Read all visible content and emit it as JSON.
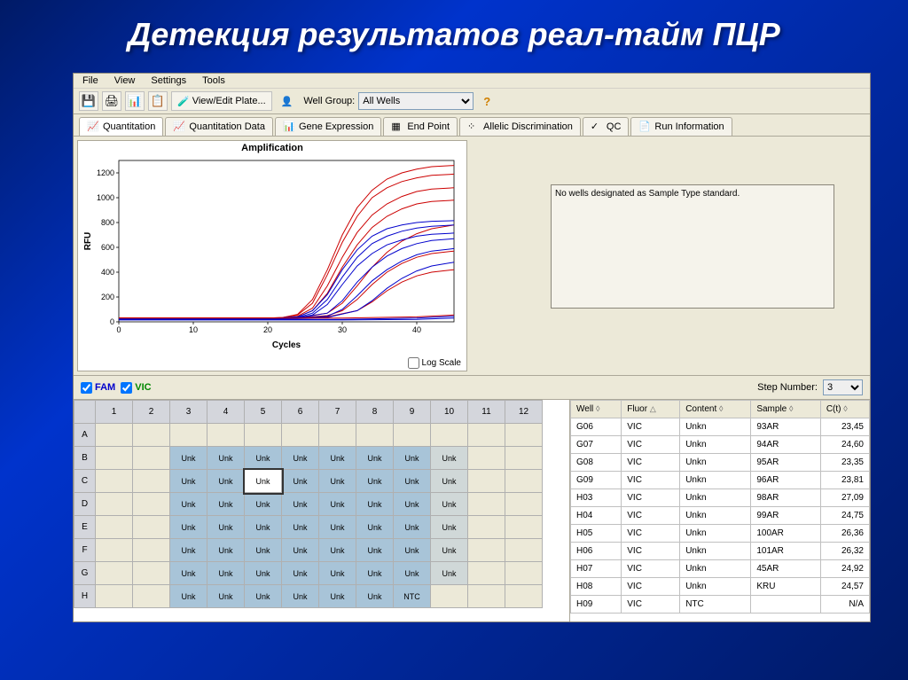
{
  "slide": {
    "title": "Детекция результатов  реал-тайм ПЦР"
  },
  "menu": {
    "file": "File",
    "view": "View",
    "settings": "Settings",
    "tools": "Tools"
  },
  "toolbar": {
    "view_edit_plate": "View/Edit Plate...",
    "well_group_label": "Well Group:",
    "well_group_value": "All Wells"
  },
  "tabs": {
    "quantitation": "Quantitation",
    "quantitation_data": "Quantitation Data",
    "gene_expression": "Gene Expression",
    "end_point": "End Point",
    "allelic": "Allelic Discrimination",
    "qc": "QC",
    "run_info": "Run Information"
  },
  "chart": {
    "title": "Amplification",
    "ylabel": "RFU",
    "xlabel": "Cycles",
    "log_scale": "Log Scale"
  },
  "chart_data": {
    "type": "line",
    "title": "Amplification",
    "xlabel": "Cycles",
    "ylabel": "RFU",
    "xlim": [
      0,
      45
    ],
    "ylim": [
      0,
      1300
    ],
    "xticks": [
      0,
      10,
      20,
      30,
      40
    ],
    "yticks": [
      0,
      200,
      400,
      600,
      800,
      1000,
      1200
    ],
    "series": [
      {
        "name": "red-high-1",
        "color": "#cc0000",
        "x": [
          0,
          5,
          10,
          15,
          20,
          22,
          24,
          26,
          28,
          30,
          32,
          34,
          36,
          38,
          40,
          42,
          45
        ],
        "y": [
          30,
          30,
          30,
          30,
          30,
          35,
          60,
          180,
          420,
          700,
          920,
          1060,
          1150,
          1200,
          1230,
          1250,
          1260
        ]
      },
      {
        "name": "red-high-2",
        "color": "#cc0000",
        "x": [
          0,
          5,
          10,
          15,
          20,
          22,
          24,
          26,
          28,
          30,
          32,
          34,
          36,
          38,
          40,
          42,
          45
        ],
        "y": [
          30,
          30,
          30,
          30,
          30,
          35,
          55,
          150,
          380,
          640,
          850,
          1000,
          1080,
          1130,
          1160,
          1180,
          1190
        ]
      },
      {
        "name": "red-mid-1",
        "color": "#cc0000",
        "x": [
          0,
          5,
          10,
          15,
          20,
          22,
          24,
          26,
          28,
          30,
          32,
          34,
          36,
          38,
          40,
          42,
          45
        ],
        "y": [
          30,
          30,
          30,
          30,
          30,
          32,
          45,
          110,
          290,
          520,
          720,
          860,
          950,
          1010,
          1050,
          1070,
          1080
        ]
      },
      {
        "name": "red-mid-2",
        "color": "#cc0000",
        "x": [
          0,
          5,
          10,
          15,
          20,
          22,
          24,
          26,
          28,
          30,
          32,
          34,
          36,
          38,
          40,
          42,
          45
        ],
        "y": [
          30,
          30,
          30,
          30,
          30,
          30,
          40,
          90,
          230,
          440,
          620,
          760,
          850,
          910,
          950,
          970,
          980
        ]
      },
      {
        "name": "red-low-1",
        "color": "#cc0000",
        "x": [
          0,
          5,
          10,
          15,
          20,
          24,
          28,
          30,
          32,
          34,
          36,
          38,
          40,
          42,
          45
        ],
        "y": [
          30,
          30,
          30,
          30,
          30,
          35,
          70,
          150,
          290,
          440,
          560,
          650,
          710,
          750,
          780
        ]
      },
      {
        "name": "red-low-2",
        "color": "#cc0000",
        "x": [
          0,
          5,
          10,
          15,
          20,
          24,
          28,
          30,
          32,
          34,
          36,
          38,
          40,
          42,
          45
        ],
        "y": [
          30,
          30,
          30,
          30,
          30,
          32,
          50,
          90,
          180,
          300,
          400,
          470,
          520,
          550,
          570
        ]
      },
      {
        "name": "red-low-3",
        "color": "#cc0000",
        "x": [
          0,
          5,
          10,
          15,
          20,
          24,
          28,
          32,
          34,
          36,
          38,
          40,
          42,
          45
        ],
        "y": [
          30,
          30,
          30,
          30,
          30,
          30,
          40,
          90,
          160,
          250,
          320,
          370,
          400,
          420
        ]
      },
      {
        "name": "blue-high-1",
        "color": "#0000cc",
        "x": [
          0,
          5,
          10,
          15,
          20,
          24,
          26,
          28,
          30,
          32,
          34,
          36,
          38,
          40,
          42,
          45
        ],
        "y": [
          25,
          25,
          25,
          25,
          25,
          40,
          90,
          220,
          420,
          580,
          690,
          750,
          780,
          800,
          810,
          815
        ]
      },
      {
        "name": "blue-high-2",
        "color": "#0000cc",
        "x": [
          0,
          5,
          10,
          15,
          20,
          24,
          26,
          28,
          30,
          32,
          34,
          36,
          38,
          40,
          42,
          45
        ],
        "y": [
          25,
          25,
          25,
          25,
          25,
          35,
          70,
          180,
          360,
          520,
          630,
          690,
          730,
          755,
          770,
          780
        ]
      },
      {
        "name": "blue-mid-1",
        "color": "#0000cc",
        "x": [
          0,
          5,
          10,
          15,
          20,
          24,
          26,
          28,
          30,
          32,
          34,
          36,
          38,
          40,
          42,
          45
        ],
        "y": [
          25,
          25,
          25,
          25,
          25,
          30,
          55,
          140,
          300,
          450,
          550,
          620,
          660,
          690,
          705,
          715
        ]
      },
      {
        "name": "blue-mid-2",
        "color": "#0000cc",
        "x": [
          0,
          5,
          10,
          15,
          20,
          24,
          28,
          30,
          32,
          34,
          36,
          38,
          40,
          42,
          45
        ],
        "y": [
          25,
          25,
          25,
          25,
          25,
          30,
          70,
          170,
          320,
          440,
          530,
          590,
          630,
          655,
          670
        ]
      },
      {
        "name": "blue-low-1",
        "color": "#0000cc",
        "x": [
          0,
          5,
          10,
          15,
          20,
          24,
          28,
          30,
          32,
          34,
          36,
          38,
          40,
          42,
          45
        ],
        "y": [
          25,
          25,
          25,
          25,
          25,
          28,
          45,
          100,
          210,
          330,
          420,
          490,
          540,
          570,
          590
        ]
      },
      {
        "name": "blue-low-2",
        "color": "#0000cc",
        "x": [
          0,
          5,
          10,
          15,
          20,
          24,
          28,
          32,
          34,
          36,
          38,
          40,
          42,
          45
        ],
        "y": [
          25,
          25,
          25,
          25,
          25,
          27,
          35,
          90,
          170,
          270,
          350,
          410,
          450,
          480
        ]
      },
      {
        "name": "flat-red-1",
        "color": "#cc0000",
        "x": [
          0,
          10,
          20,
          30,
          40,
          45
        ],
        "y": [
          30,
          30,
          30,
          30,
          40,
          55
        ]
      },
      {
        "name": "flat-blue-1",
        "color": "#0000cc",
        "x": [
          0,
          10,
          20,
          30,
          40,
          45
        ],
        "y": [
          20,
          20,
          20,
          20,
          30,
          45
        ]
      },
      {
        "name": "flat-blue-2",
        "color": "#0000cc",
        "x": [
          0,
          10,
          20,
          30,
          40,
          45
        ],
        "y": [
          15,
          15,
          15,
          15,
          20,
          30
        ]
      }
    ]
  },
  "info_panel": {
    "message": "No wells designated as Sample Type standard."
  },
  "fluor": {
    "fam": "FAM",
    "vic": "VIC",
    "step_label": "Step Number:",
    "step_value": "3"
  },
  "plate": {
    "cols": [
      "1",
      "2",
      "3",
      "4",
      "5",
      "6",
      "7",
      "8",
      "9",
      "10",
      "11",
      "12"
    ],
    "rows": [
      "A",
      "B",
      "C",
      "D",
      "E",
      "F",
      "G",
      "H"
    ],
    "unk_label": "Unk",
    "ntc_label": "NTC",
    "layout": {
      "A": [
        "",
        "",
        "",
        "",
        "",
        "",
        "",
        "",
        "",
        "",
        "",
        ""
      ],
      "B": [
        "",
        "",
        "Unk",
        "Unk",
        "Unk",
        "Unk",
        "Unk",
        "Unk",
        "Unk",
        "UnkL",
        "",
        ""
      ],
      "C": [
        "",
        "",
        "Unk",
        "Unk",
        "UnkS",
        "Unk",
        "Unk",
        "Unk",
        "Unk",
        "UnkL",
        "",
        ""
      ],
      "D": [
        "",
        "",
        "Unk",
        "Unk",
        "Unk",
        "Unk",
        "Unk",
        "Unk",
        "Unk",
        "UnkL",
        "",
        ""
      ],
      "E": [
        "",
        "",
        "Unk",
        "Unk",
        "Unk",
        "Unk",
        "Unk",
        "Unk",
        "Unk",
        "UnkL",
        "",
        ""
      ],
      "F": [
        "",
        "",
        "Unk",
        "Unk",
        "Unk",
        "Unk",
        "Unk",
        "Unk",
        "Unk",
        "UnkL",
        "",
        ""
      ],
      "G": [
        "",
        "",
        "Unk",
        "Unk",
        "Unk",
        "Unk",
        "Unk",
        "Unk",
        "Unk",
        "UnkL",
        "",
        ""
      ],
      "H": [
        "",
        "",
        "Unk",
        "Unk",
        "Unk",
        "Unk",
        "Unk",
        "Unk",
        "NTC",
        "",
        "",
        ""
      ]
    }
  },
  "data_table": {
    "headers": {
      "well": "Well",
      "fluor": "Fluor",
      "content": "Content",
      "sample": "Sample",
      "cq": "C(t)"
    },
    "rows": [
      {
        "well": "G06",
        "fluor": "VIC",
        "content": "Unkn",
        "sample": "93AR",
        "cq": "23,45"
      },
      {
        "well": "G07",
        "fluor": "VIC",
        "content": "Unkn",
        "sample": "94AR",
        "cq": "24,60"
      },
      {
        "well": "G08",
        "fluor": "VIC",
        "content": "Unkn",
        "sample": "95AR",
        "cq": "23,35"
      },
      {
        "well": "G09",
        "fluor": "VIC",
        "content": "Unkn",
        "sample": "96AR",
        "cq": "23,81"
      },
      {
        "well": "H03",
        "fluor": "VIC",
        "content": "Unkn",
        "sample": "98AR",
        "cq": "27,09"
      },
      {
        "well": "H04",
        "fluor": "VIC",
        "content": "Unkn",
        "sample": "99AR",
        "cq": "24,75"
      },
      {
        "well": "H05",
        "fluor": "VIC",
        "content": "Unkn",
        "sample": "100AR",
        "cq": "26,36"
      },
      {
        "well": "H06",
        "fluor": "VIC",
        "content": "Unkn",
        "sample": "101AR",
        "cq": "26,32"
      },
      {
        "well": "H07",
        "fluor": "VIC",
        "content": "Unkn",
        "sample": "45AR",
        "cq": "24,92"
      },
      {
        "well": "H08",
        "fluor": "VIC",
        "content": "Unkn",
        "sample": "KRU",
        "cq": "24,57"
      },
      {
        "well": "H09",
        "fluor": "VIC",
        "content": "NTC",
        "sample": "",
        "cq": "N/A"
      }
    ]
  }
}
